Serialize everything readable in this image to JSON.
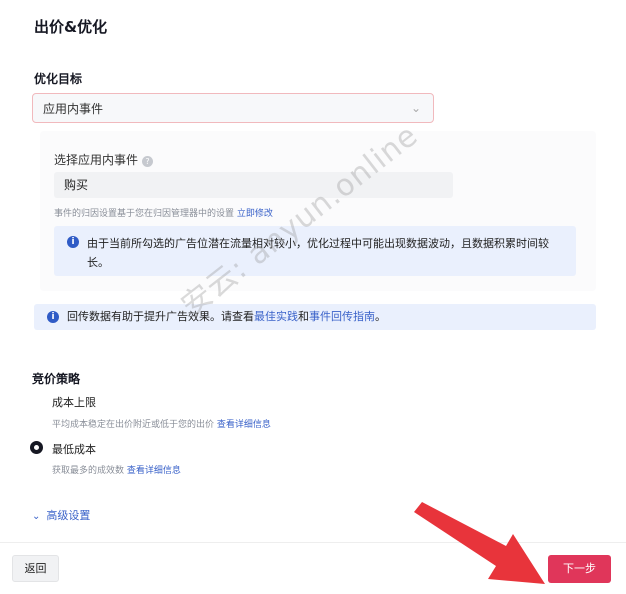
{
  "page": {
    "title": "出价&优化"
  },
  "optimization": {
    "label": "优化目标",
    "selected": "应用内事件",
    "app_event": {
      "label": "选择应用内事件",
      "value": "购买"
    },
    "attribution_note": "事件的归因设置基于您在归因管理器中的设置",
    "attribution_link": "立即修改",
    "notice": "由于当前所勾选的广告位潜在流量相对较小，优化过程中可能出现数据波动，且数据积累时间较长。"
  },
  "postback": {
    "text_prefix": "回传数据有助于提升广告效果。请查看",
    "link1": "最佳实践",
    "joiner": "和",
    "link2": "事件回传指南",
    "suffix": "。"
  },
  "bid_strategy": {
    "label": "竞价策略",
    "options": [
      {
        "label": "成本上限",
        "desc": "平均成本稳定在出价附近或低于您的出价",
        "link": "查看详细信息"
      },
      {
        "label": "最低成本",
        "desc": "获取最多的成效数",
        "link": "查看详细信息",
        "selected": true
      }
    ]
  },
  "advanced": {
    "label": "高级设置"
  },
  "footer": {
    "back": "返回",
    "next": "下一步"
  },
  "watermark": "安云: anyun.online",
  "colors": {
    "accent": "#e0365a",
    "link": "#3a62c9",
    "info_bg": "#eaf0fd",
    "arrow": "#e8343b"
  }
}
